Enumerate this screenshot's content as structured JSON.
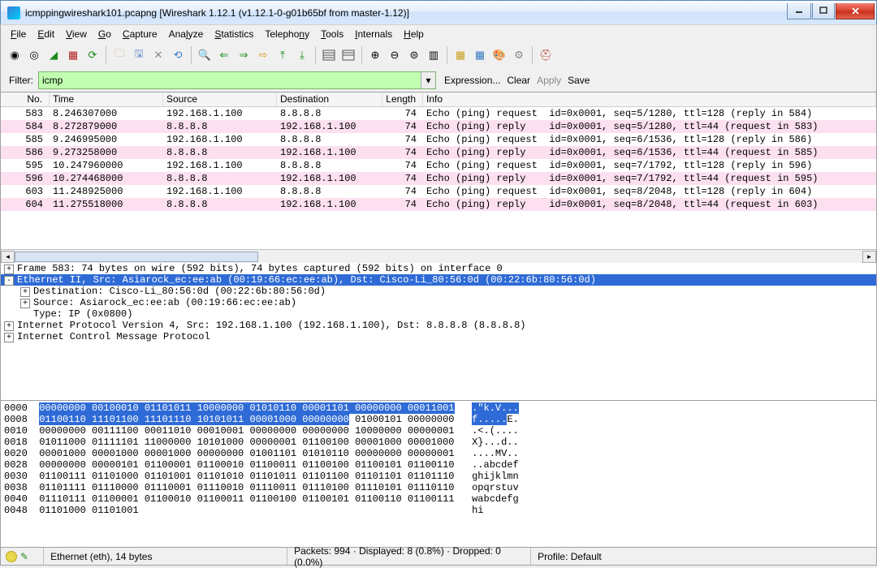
{
  "title": "icmppingwireshark101.pcapng   [Wireshark 1.12.1  (v1.12.1-0-g01b65bf from master-1.12)]",
  "menu": [
    "File",
    "Edit",
    "View",
    "Go",
    "Capture",
    "Analyze",
    "Statistics",
    "Telephony",
    "Tools",
    "Internals",
    "Help"
  ],
  "menu_hotkeys": [
    0,
    0,
    0,
    0,
    0,
    3,
    0,
    7,
    0,
    0,
    0
  ],
  "filter": {
    "label": "Filter:",
    "value": "icmp",
    "actions": [
      "Expression...",
      "Clear",
      "Apply",
      "Save"
    ],
    "apply_disabled": true
  },
  "columns": [
    "No.",
    "Time",
    "Source",
    "Destination",
    "Length",
    "Info"
  ],
  "packets": [
    {
      "no": "583",
      "time": "8.246307000",
      "src": "192.168.1.100",
      "dst": "8.8.8.8",
      "len": "74",
      "info": "Echo (ping) request  id=0x0001, seq=5/1280, ttl=128 (reply in 584)",
      "reply": false
    },
    {
      "no": "584",
      "time": "8.272879000",
      "src": "8.8.8.8",
      "dst": "192.168.1.100",
      "len": "74",
      "info": "Echo (ping) reply    id=0x0001, seq=5/1280, ttl=44 (request in 583)",
      "reply": true
    },
    {
      "no": "585",
      "time": "9.246995000",
      "src": "192.168.1.100",
      "dst": "8.8.8.8",
      "len": "74",
      "info": "Echo (ping) request  id=0x0001, seq=6/1536, ttl=128 (reply in 586)",
      "reply": false
    },
    {
      "no": "586",
      "time": "9.273258000",
      "src": "8.8.8.8",
      "dst": "192.168.1.100",
      "len": "74",
      "info": "Echo (ping) reply    id=0x0001, seq=6/1536, ttl=44 (request in 585)",
      "reply": true
    },
    {
      "no": "595",
      "time": "10.247960000",
      "src": "192.168.1.100",
      "dst": "8.8.8.8",
      "len": "74",
      "info": "Echo (ping) request  id=0x0001, seq=7/1792, ttl=128 (reply in 596)",
      "reply": false
    },
    {
      "no": "596",
      "time": "10.274468000",
      "src": "8.8.8.8",
      "dst": "192.168.1.100",
      "len": "74",
      "info": "Echo (ping) reply    id=0x0001, seq=7/1792, ttl=44 (request in 595)",
      "reply": true
    },
    {
      "no": "603",
      "time": "11.248925000",
      "src": "192.168.1.100",
      "dst": "8.8.8.8",
      "len": "74",
      "info": "Echo (ping) request  id=0x0001, seq=8/2048, ttl=128 (reply in 604)",
      "reply": false
    },
    {
      "no": "604",
      "time": "11.275518000",
      "src": "8.8.8.8",
      "dst": "192.168.1.100",
      "len": "74",
      "info": "Echo (ping) reply    id=0x0001, seq=8/2048, ttl=44 (request in 603)",
      "reply": true
    }
  ],
  "tree": [
    {
      "level": 0,
      "exp": "+",
      "text": "Frame 583: 74 bytes on wire (592 bits), 74 bytes captured (592 bits) on interface 0",
      "sel": false
    },
    {
      "level": 0,
      "exp": "-",
      "text": "Ethernet II, Src: Asiarock_ec:ee:ab (00:19:66:ec:ee:ab), Dst: Cisco-Li_80:56:0d (00:22:6b:80:56:0d)",
      "sel": true
    },
    {
      "level": 1,
      "exp": "+",
      "text": "Destination: Cisco-Li_80:56:0d (00:22:6b:80:56:0d)",
      "sel": false
    },
    {
      "level": 1,
      "exp": "+",
      "text": "Source: Asiarock_ec:ee:ab (00:19:66:ec:ee:ab)",
      "sel": false
    },
    {
      "level": 1,
      "exp": "",
      "text": "Type: IP (0x0800)",
      "sel": false
    },
    {
      "level": 0,
      "exp": "+",
      "text": "Internet Protocol Version 4, Src: 192.168.1.100 (192.168.1.100), Dst: 8.8.8.8 (8.8.8.8)",
      "sel": false
    },
    {
      "level": 0,
      "exp": "+",
      "text": "Internet Control Message Protocol",
      "sel": false
    }
  ],
  "hex": [
    {
      "off": "0000",
      "bytes": "00000000 00100010 01101011 10000000 01010110 00001101 00000000 00011001",
      "ascii": ".\"k.V...",
      "hl_bytes": true,
      "hl_ascii": true
    },
    {
      "off": "0008",
      "bytes_hl": "01100110 11101100 11101110 10101011 00001000 00000000",
      "bytes_rest": " 01000101 00000000",
      "ascii_hl": "f.....",
      "ascii_rest": "E.",
      "hl_partial": true
    },
    {
      "off": "0010",
      "bytes": "00000000 00111100 00011010 00010001 00000000 00000000 10000000 00000001",
      "ascii": ".<.(...."
    },
    {
      "off": "0018",
      "bytes": "01011000 01111101 11000000 10101000 00000001 01100100 00001000 00001000",
      "ascii": "X}...d.."
    },
    {
      "off": "0020",
      "bytes": "00001000 00001000 00001000 00000000 01001101 01010110 00000000 00000001",
      "ascii": "....MV.."
    },
    {
      "off": "0028",
      "bytes": "00000000 00000101 01100001 01100010 01100011 01100100 01100101 01100110",
      "ascii": "..abcdef"
    },
    {
      "off": "0030",
      "bytes": "01100111 01101000 01101001 01101010 01101011 01101100 01101101 01101110",
      "ascii": "ghijklmn"
    },
    {
      "off": "0038",
      "bytes": "01101111 01110000 01110001 01110010 01110011 01110100 01110101 01110110",
      "ascii": "opqrstuv"
    },
    {
      "off": "0040",
      "bytes": "01110111 01100001 01100010 01100011 01100100 01100101 01100110 01100111",
      "ascii": "wabcdefg"
    },
    {
      "off": "0048",
      "bytes": "01101000 01101001",
      "ascii": "hi"
    }
  ],
  "status": {
    "left": "Ethernet (eth), 14 bytes",
    "mid": "Packets: 994 · Displayed: 8 (0.8%) · Dropped: 0 (0.0%)",
    "right": "Profile: Default"
  }
}
